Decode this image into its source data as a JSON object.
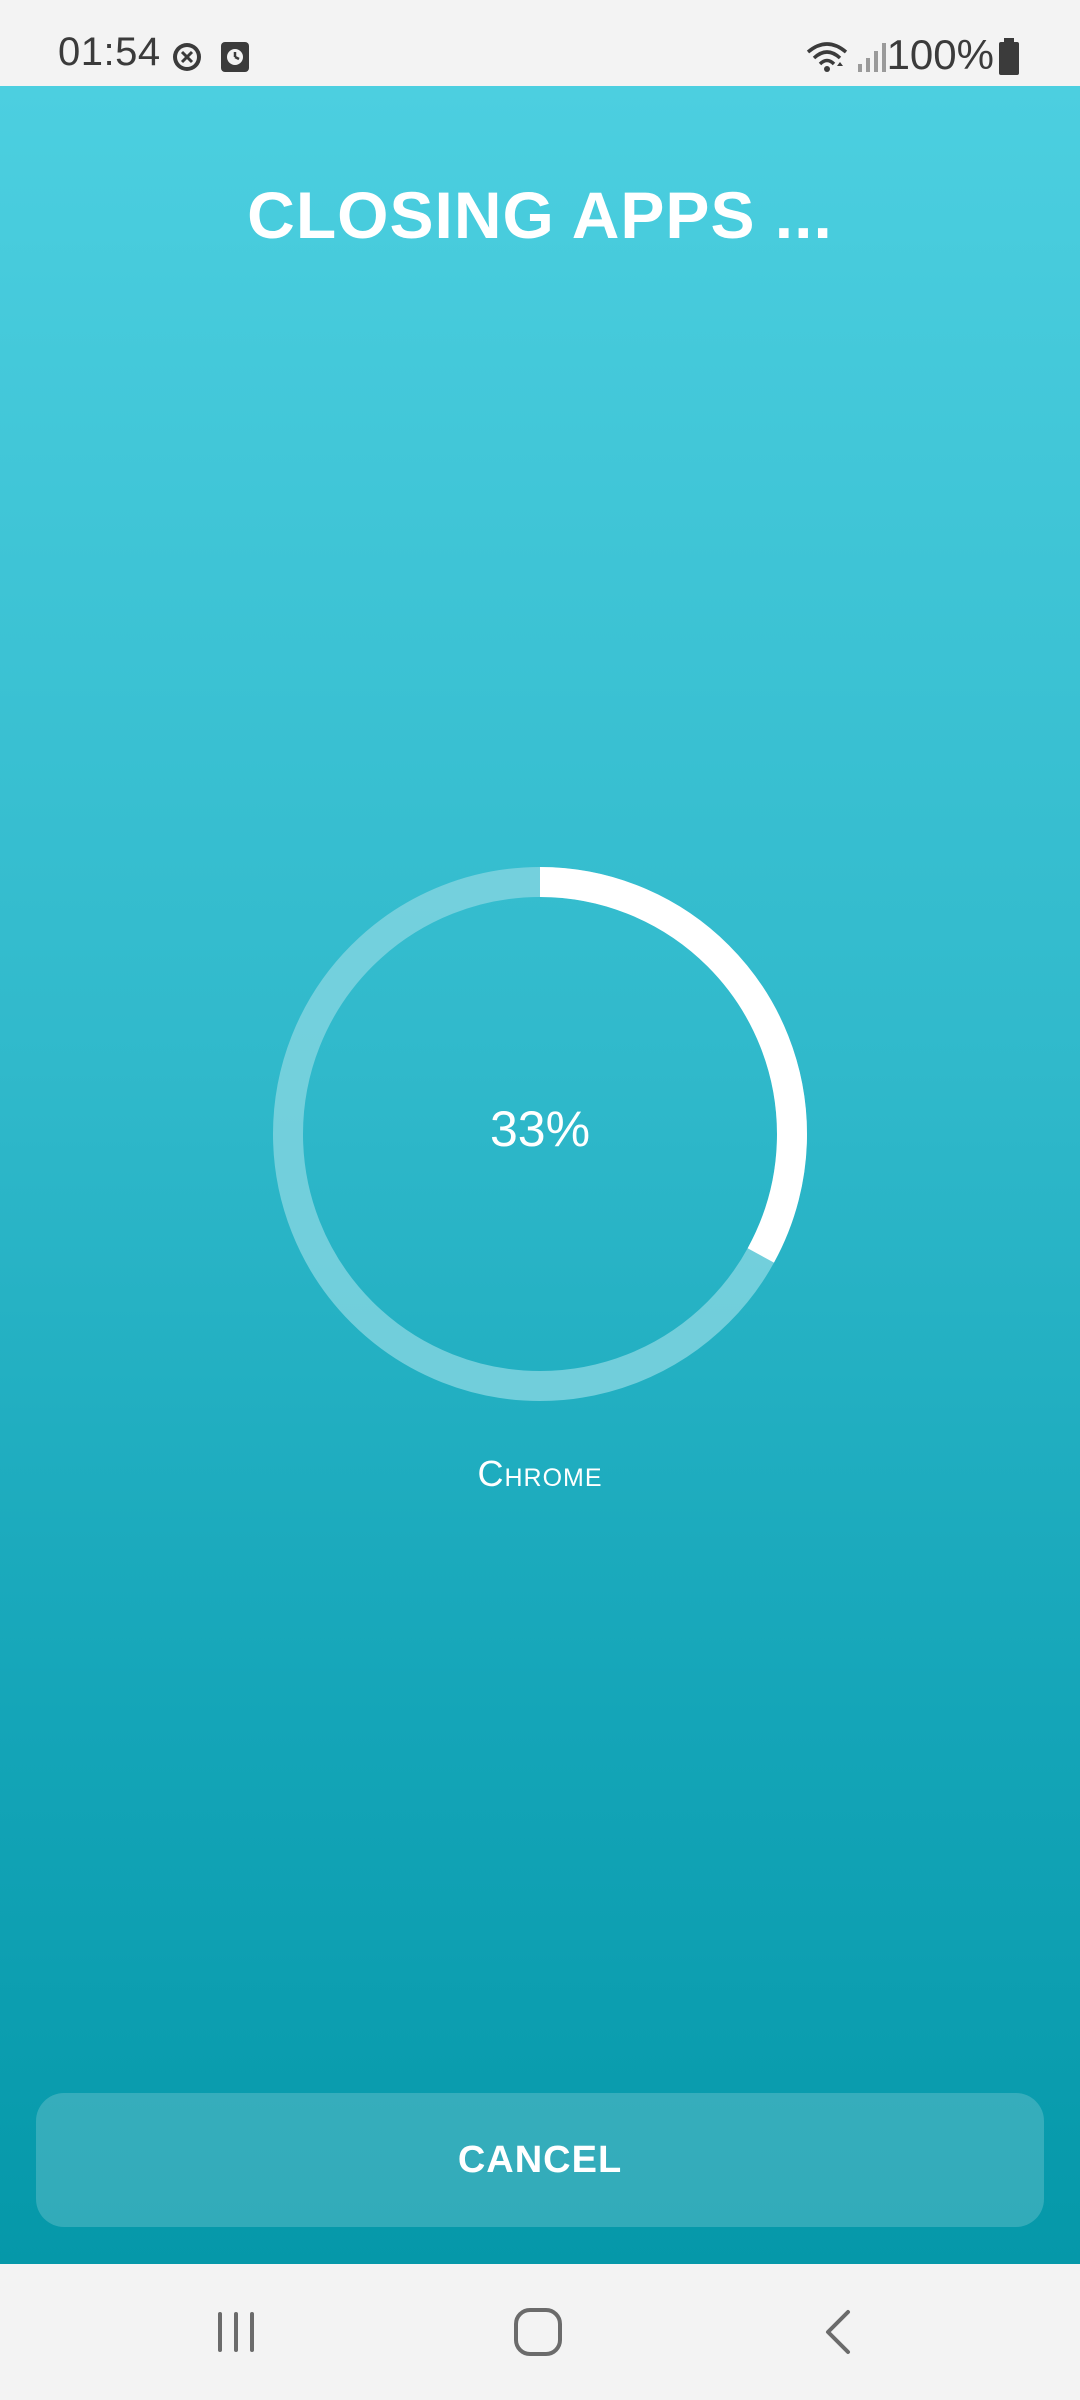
{
  "status_bar": {
    "time": "01:54",
    "battery_text": "100%",
    "icons": [
      "blocked-circle-icon",
      "clock-icon",
      "wifi-icon",
      "signal-icon",
      "battery-icon"
    ]
  },
  "main": {
    "title": "CLOSING APPS ...",
    "progress": {
      "percent_label": "33%",
      "value_percent": 33,
      "current_app": "Chrome"
    },
    "cancel_label": "CANCEL"
  },
  "nav_bar": {
    "icons": [
      "recent-apps-icon",
      "home-icon",
      "back-icon"
    ]
  },
  "colors": {
    "gradient_top": "#4ccfe0",
    "gradient_bottom": "#0598a9",
    "ring_track": "#7fd3df",
    "ring_progress": "#ffffff"
  }
}
